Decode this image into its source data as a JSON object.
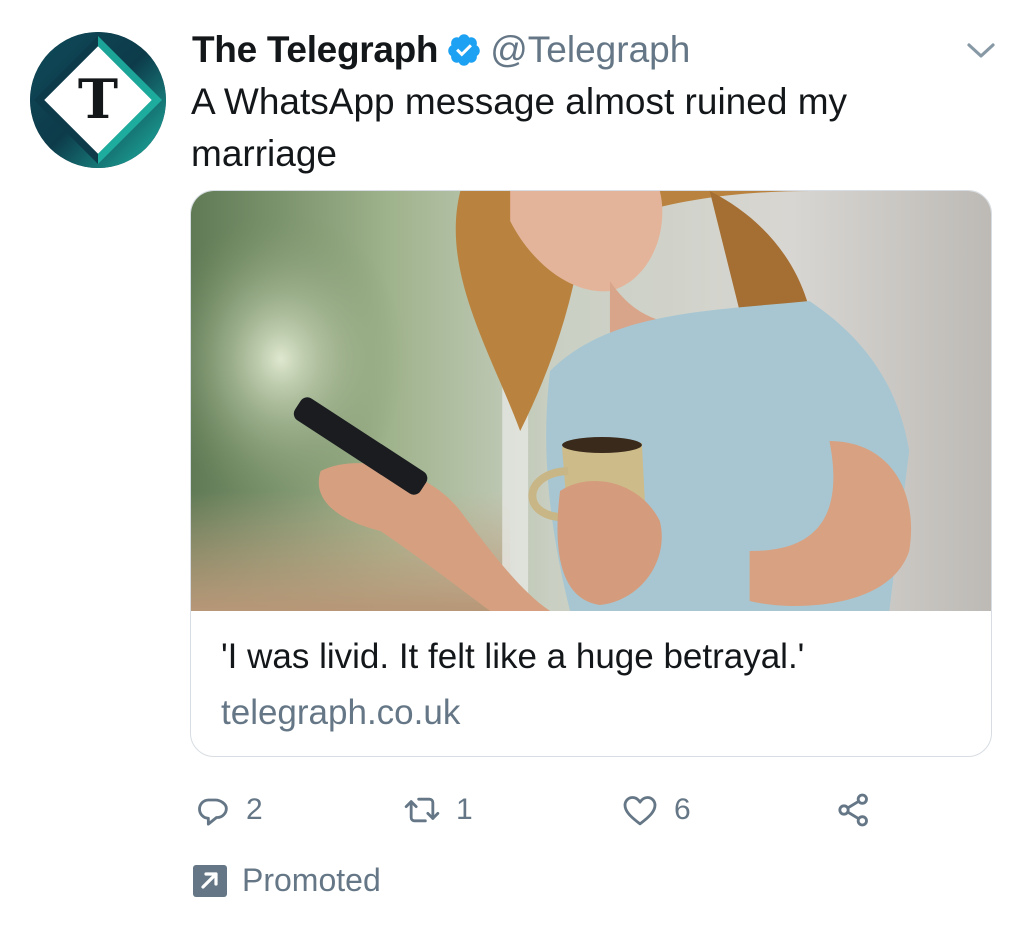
{
  "tweet": {
    "author_name": "The Telegraph",
    "handle": "@Telegraph",
    "text": "A WhatsApp message almost ruined my marriage",
    "avatar_letter": "T",
    "verified_icon": "verified-badge-icon",
    "menu_icon": "chevron-down-icon"
  },
  "card": {
    "title": "'I was livid. It felt like a huge betrayal.'",
    "domain": "telegraph.co.uk",
    "image_description_icon": "photo-woman-reading-phone"
  },
  "actions": {
    "replies": "2",
    "retweets": "1",
    "likes": "6",
    "reply_icon": "reply-icon",
    "retweet_icon": "retweet-icon",
    "like_icon": "heart-icon",
    "share_icon": "share-icon"
  },
  "promoted": {
    "label": "Promoted",
    "icon": "promoted-arrow-icon"
  },
  "colors": {
    "verified": "#1da1f2",
    "secondary_text": "#657786",
    "primary_text": "#14171a",
    "brand_teal": "#1fb6a5",
    "brand_navy": "#0d3b4a"
  }
}
